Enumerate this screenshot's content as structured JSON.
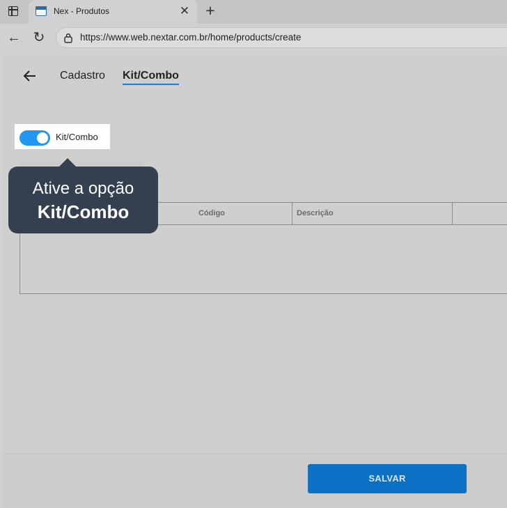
{
  "browser": {
    "tab_title": "Nex - Produtos",
    "close_icon": "close-icon",
    "new_tab_icon": "plus-icon",
    "url": "https://www.web.nextar.com.br/home/products/create"
  },
  "page": {
    "tabs": [
      {
        "label": "Cadastro",
        "active": false
      },
      {
        "label": "Kit/Combo",
        "active": true
      }
    ],
    "kit_toggle": {
      "label": "Kit/Combo",
      "on": true
    },
    "table": {
      "headers": [
        "Código",
        "Descrição"
      ]
    },
    "tooltip": {
      "line1": "Ative a opção",
      "line2": "Kit/Combo"
    },
    "save_label": "SALVAR"
  },
  "colors": {
    "accent": "#2196f3",
    "save_button": "#0a71c4",
    "tooltip_bg": "#344050"
  }
}
